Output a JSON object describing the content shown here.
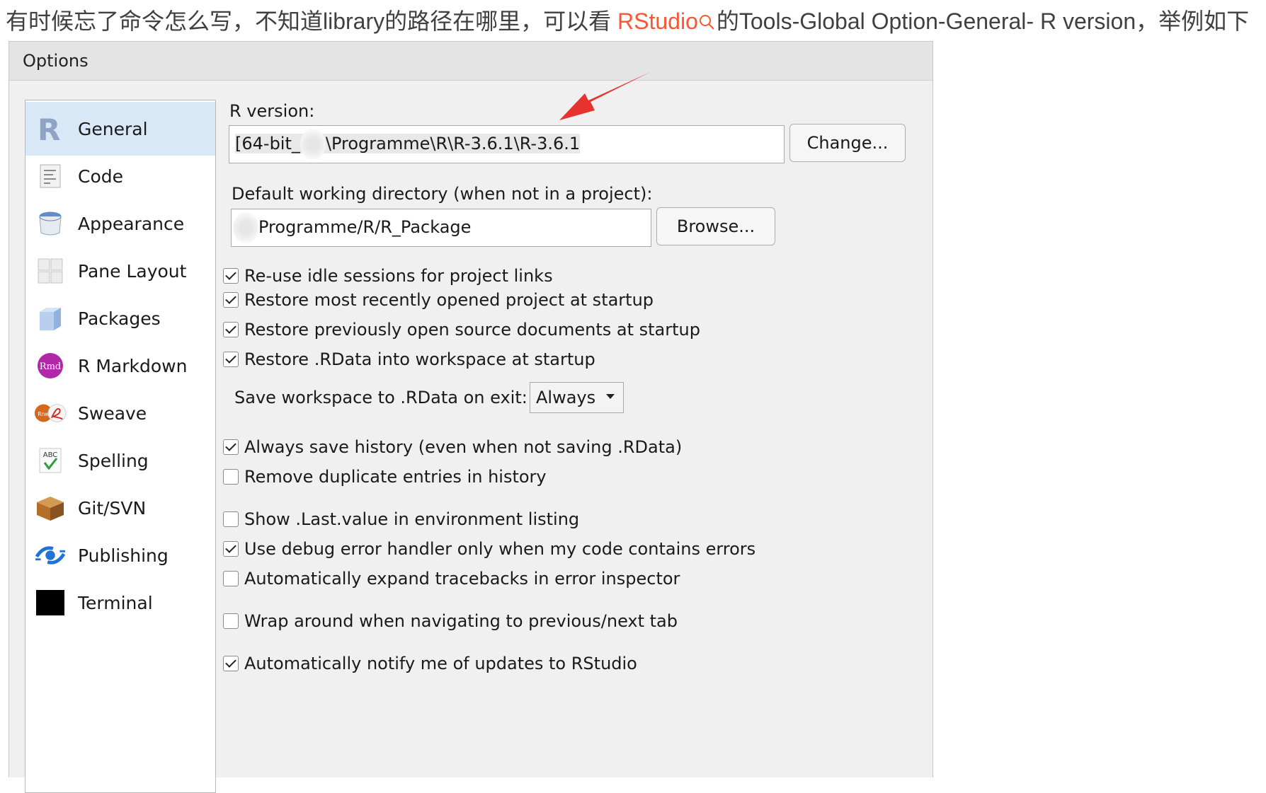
{
  "intro": {
    "before": "有时候忘了命令怎么写，不知道library的路径在哪里，可以看 ",
    "link": "RStudio",
    "after": "的Tools-Global Option-General- R version，举例如下"
  },
  "dialog": {
    "title": "Options",
    "sidebar": [
      {
        "label": "General",
        "icon": "r-logo-icon",
        "selected": true
      },
      {
        "label": "Code",
        "icon": "code-document-icon"
      },
      {
        "label": "Appearance",
        "icon": "paint-bucket-icon"
      },
      {
        "label": "Pane Layout",
        "icon": "grid-panes-icon"
      },
      {
        "label": "Packages",
        "icon": "package-box-icon"
      },
      {
        "label": "R Markdown",
        "icon": "rmd-badge-icon"
      },
      {
        "label": "Sweave",
        "icon": "sweave-pdf-icon"
      },
      {
        "label": "Spelling",
        "icon": "abc-check-icon"
      },
      {
        "label": "Git/SVN",
        "icon": "git-box-icon"
      },
      {
        "label": "Publishing",
        "icon": "publish-eye-icon"
      },
      {
        "label": "Terminal",
        "icon": "terminal-icon"
      }
    ],
    "r_version": {
      "label": "R version:",
      "value_prefix": "[64-bit_",
      "value_suffix": "\\Programme\\R\\R-3.6.1\\R-3.6.1",
      "change_label": "Change..."
    },
    "workdir": {
      "label": "Default working directory (when not in a project):",
      "value": "Programme/R/R_Package",
      "browse_label": "Browse..."
    },
    "checks": [
      {
        "label": "Re-use idle sessions for project links",
        "checked": true
      },
      {
        "label": "Restore most recently opened project at startup",
        "checked": true
      },
      {
        "label": "Restore previously open source documents at startup",
        "checked": true
      },
      {
        "label": "Restore .RData into workspace at startup",
        "checked": true
      },
      {
        "label": "Always save history (even when not saving .RData)",
        "checked": true
      },
      {
        "label": "Remove duplicate entries in history",
        "checked": false
      },
      {
        "label": "Show .Last.value in environment listing",
        "checked": false
      },
      {
        "label": "Use debug error handler only when my code contains errors",
        "checked": true
      },
      {
        "label": "Automatically expand tracebacks in error inspector",
        "checked": false
      },
      {
        "label": "Wrap around when navigating to previous/next tab",
        "checked": false
      },
      {
        "label": "Automatically notify me of updates to RStudio",
        "checked": true
      }
    ],
    "save_workspace": {
      "label": "Save workspace to .RData on exit:",
      "value": "Always"
    }
  },
  "colors": {
    "link": "#fc5531",
    "arrow": "#e8322d",
    "selected_bg": "#d8e8f6"
  }
}
